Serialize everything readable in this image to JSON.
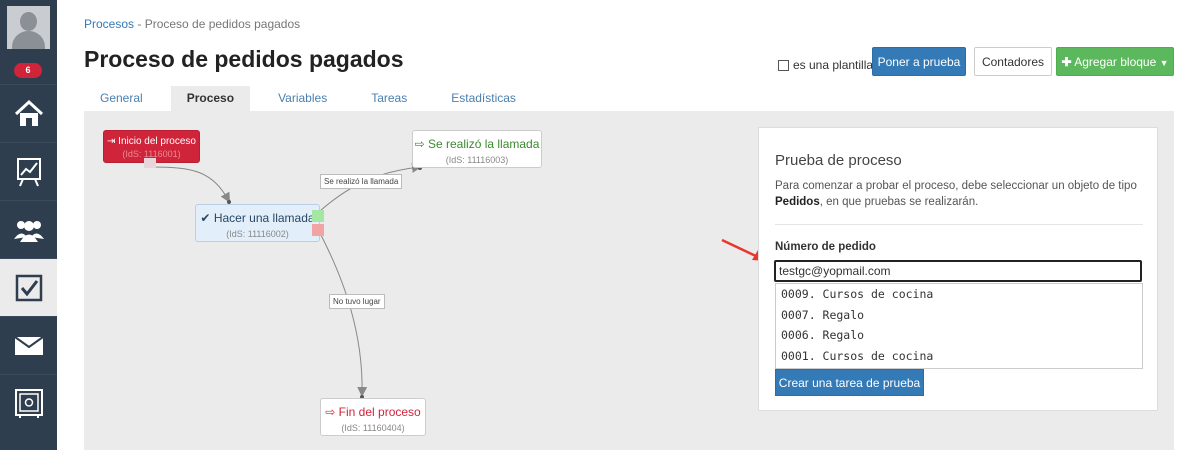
{
  "sidebar": {
    "notification_count": "6",
    "items": [
      {
        "icon": "home-icon"
      },
      {
        "icon": "chart-icon"
      },
      {
        "icon": "users-icon"
      },
      {
        "icon": "checkbox-icon",
        "active": true
      },
      {
        "icon": "mail-icon"
      },
      {
        "icon": "safe-icon"
      }
    ]
  },
  "breadcrumb": {
    "link": "Procesos",
    "separator": " - ",
    "current": "Proceso de pedidos pagados"
  },
  "header": {
    "title": "Proceso de pedidos pagados",
    "template_label": "es una plantilla",
    "test_button": "Poner a prueba",
    "counters_button": "Contadores",
    "add_block_button": "Agregar bloque"
  },
  "tabs": [
    {
      "label": "General"
    },
    {
      "label": "Proceso",
      "active": true
    },
    {
      "label": "Variables"
    },
    {
      "label": "Tareas"
    },
    {
      "label": "Estadísticas"
    }
  ],
  "flow": {
    "start": {
      "title": "Inicio del proceso",
      "sub": "(IdS: 1116001)"
    },
    "call": {
      "title": "Hacer una llamada",
      "sub": "(IdS: 11116002)"
    },
    "done": {
      "title": "Se realizó la llamada",
      "sub": "(IdS: 11116003)"
    },
    "end": {
      "title": "Fin del proceso",
      "sub": "(IdS: 11160404)"
    },
    "edge_done_label": "Se realizó la llamada",
    "edge_fail_label": "No tuvo lugar"
  },
  "test_panel": {
    "title": "Prueba de proceso",
    "description_pre": "Para comenzar a probar el proceso, debe seleccionar un objeto de tipo ",
    "description_bold": "Pedidos",
    "description_post": ", en que pruebas se realizarán.",
    "field_label": "Número de pedido",
    "input_value": "testgc@yopmail.com",
    "options": [
      "0009. Cursos de cocina",
      "0007. Regalo",
      "0006. Regalo",
      "0001. Cursos de cocina"
    ],
    "create_button": "Crear una tarea de prueba"
  },
  "colors": {
    "sidebar_bg": "#2e3e4e",
    "primary": "#337ab7",
    "success": "#5cb85c",
    "danger": "#d0243a",
    "canvas_bg": "#ebebeb"
  }
}
